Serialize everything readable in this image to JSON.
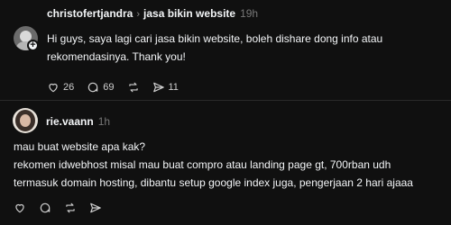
{
  "posts": [
    {
      "username": "christofertjandra",
      "topic": "jasa bikin website",
      "time": "19h",
      "lines": [
        "Hi guys, saya lagi cari jasa bikin website, boleh dishare dong info atau",
        "rekomendasinya. Thank you!"
      ],
      "likes": "26",
      "replies": "69",
      "shares": "11"
    },
    {
      "username": "rie.vaann",
      "time": "1h",
      "lines": [
        "mau buat website apa kak?",
        "rekomen idwebhost misal mau buat compro atau landing page gt, 700rban udh",
        "termasuk domain hosting, dibantu setup google index juga, pengerjaan 2 hari ajaaa"
      ]
    }
  ],
  "icons": {
    "like": "heart-icon",
    "reply": "comment-icon",
    "repost": "repost-icon",
    "share": "send-icon",
    "follow": "plus-icon",
    "separator": "chevron-right-icon"
  },
  "colors": {
    "background": "#101010",
    "text": "#f3f5f7",
    "muted": "#777777",
    "divider": "#2a2a2a"
  }
}
